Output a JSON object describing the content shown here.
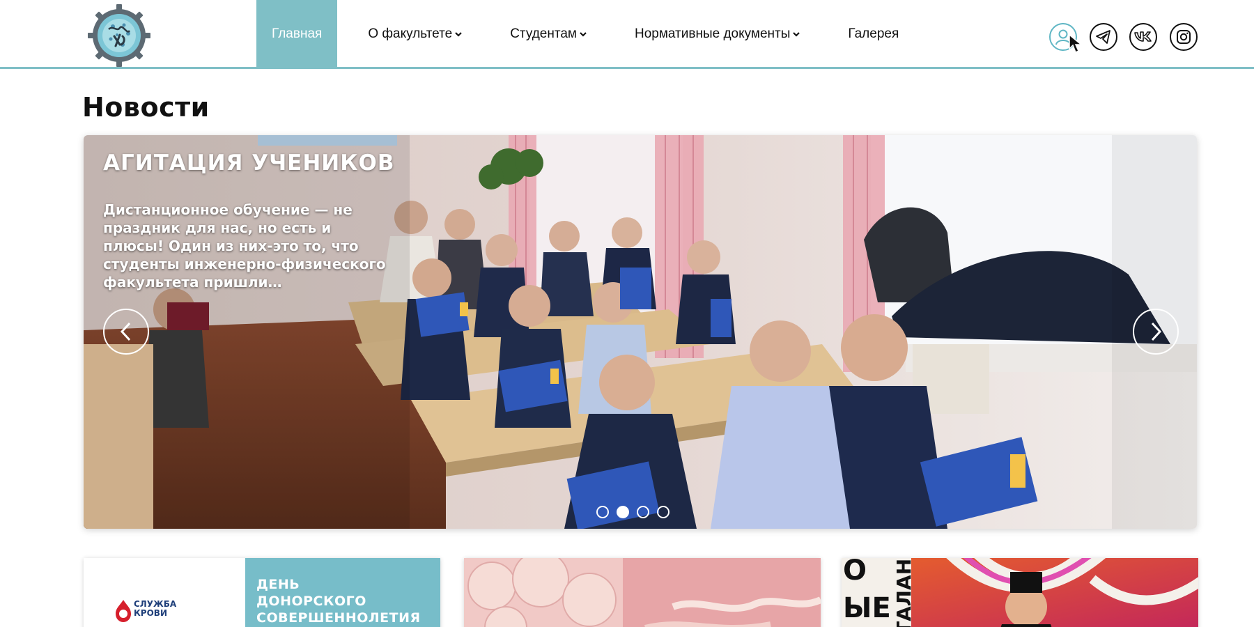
{
  "nav": {
    "items": [
      {
        "label": "Главная",
        "active": true,
        "dropdown": false
      },
      {
        "label": "О факультете",
        "active": false,
        "dropdown": true
      },
      {
        "label": "Студентам",
        "active": false,
        "dropdown": true
      },
      {
        "label": "Нормативные документы",
        "active": false,
        "dropdown": true
      },
      {
        "label": "Галерея",
        "active": false,
        "dropdown": false
      }
    ]
  },
  "social": [
    "user-icon",
    "telegram-icon",
    "vk-icon",
    "instagram-icon"
  ],
  "page_title": "Новости",
  "slider": {
    "title": "АГИТАЦИЯ УЧЕНИКОВ",
    "text": "Дистанционное обучение — не праздник для нас, но есть и плюсы! Один из них-это то, что студенты инженерно-физического факультета пришли…",
    "slide_count": 4,
    "active_slide": 2
  },
  "cards": [
    {
      "title_lines": [
        "ДЕНЬ",
        "ДОНОРСКОГО",
        "СОВЕРШЕННОЛЕТИЯ"
      ],
      "logo_text": [
        "СЛУЖБА",
        "КРОВИ"
      ]
    },
    {},
    {
      "text_left": "О",
      "text_left2": "ЫЕ",
      "vertical": "ТАЛАН"
    }
  ],
  "colors": {
    "accent": "#7fbfc6",
    "card_teal": "#77bdc9",
    "text": "#111111"
  }
}
